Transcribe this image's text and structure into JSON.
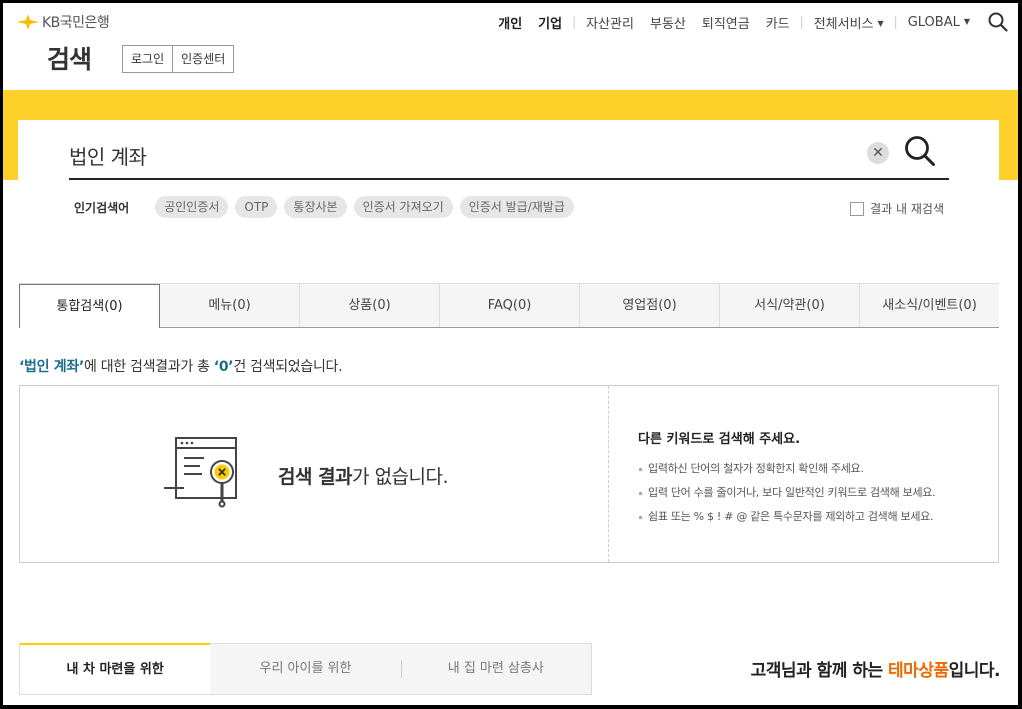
{
  "header": {
    "logo_text": "KB국민은행",
    "page_title": "검색",
    "auth_links": [
      "로그인",
      "인증센터"
    ],
    "gnb": {
      "personal": "개인",
      "corporate": "기업",
      "asset": "자산관리",
      "realestate": "부동산",
      "pension": "퇴직연금",
      "card": "카드",
      "all_services": "전체서비스",
      "global": "GLOBAL"
    }
  },
  "search": {
    "query": "법인 계좌",
    "popular_label": "인기검색어",
    "popular_keywords": [
      "공인인증서",
      "OTP",
      "통장사본",
      "인증서 가져오기",
      "인증서 발급/재발급"
    ],
    "recheck_label": "결과 내 재검색"
  },
  "tabs": [
    "통합검색(0)",
    "메뉴(0)",
    "상품(0)",
    "FAQ(0)",
    "영업점(0)",
    "서식/약관(0)",
    "새소식/이벤트(0)"
  ],
  "summary": {
    "open_q": "‘",
    "keyword": "법인 계좌",
    "close_q": "’",
    "mid": "에 대한 검색결과가 총 ",
    "count_open": "‘",
    "count": "0",
    "count_close": "’",
    "tail": "건 검색되었습니다."
  },
  "no_result": {
    "bold": "검색 결과",
    "rest": "가 없습니다."
  },
  "tips": {
    "title": "다른 키워드로 검색해 주세요.",
    "items": [
      "입력하신 단어의 철자가 정확한지 확인해 주세요.",
      "입력 단어 수를 줄이거나, 보다 일반적인 키워드로 검색해 보세요.",
      "쉼표 또는 % $ ! # @ 같은 특수문자를 제외하고 검색해 보세요."
    ]
  },
  "theme": {
    "tabs": [
      "내 차 마련을 위한",
      "우리 아이를 위한",
      "내 집 마련 삼총사"
    ],
    "title_pre": "고객님과 함께 하는 ",
    "title_hl": "테마상품",
    "title_post": "입니다."
  },
  "colors": {
    "brand_yellow": "#ffd12a",
    "keyword_blue": "#1d6d8f",
    "theme_orange": "#ee6a00"
  }
}
